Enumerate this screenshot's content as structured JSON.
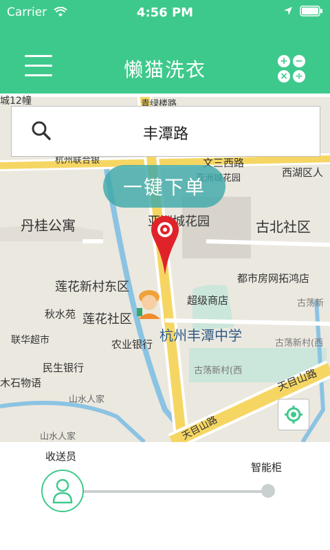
{
  "status_bar": {
    "carrier": "Carrier",
    "time": "4:56 PM"
  },
  "header": {
    "title": "懒猫洗衣"
  },
  "search": {
    "query": "丰潭路"
  },
  "order_button": {
    "label": "一键下单"
  },
  "map_labels": [
    "城12幢",
    "青绿楼路",
    "杭州联合银",
    "文三西路",
    "亚洲城花园",
    "西湖区人",
    "丹桂公寓",
    "亚洲城花园",
    "古北社区",
    "莲花新村东区",
    "都市房网拓鸿店",
    "秋水苑",
    "超级商店",
    "莲花社区",
    "古荡新",
    "联华超市",
    "农业银行",
    "杭州丰潭中学",
    "古荡新村(西",
    "民生银行",
    "古荡新村(西",
    "木石物语",
    "山水人家",
    "天目山路",
    "天目山路",
    "山水人家"
  ],
  "bottom": {
    "left_label": "收送员",
    "right_label": "智能柜"
  },
  "colors": {
    "accent": "#3ec98c",
    "pin": "#e0232a"
  }
}
